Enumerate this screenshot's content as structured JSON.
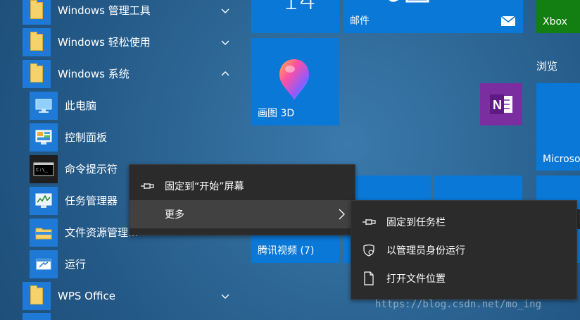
{
  "app_list": {
    "folders": [
      {
        "label": "Windows 管理工具",
        "expanded": false
      },
      {
        "label": "Windows 轻松使用",
        "expanded": false
      },
      {
        "label": "Windows 系统",
        "expanded": true
      }
    ],
    "system_items": [
      {
        "label": "此电脑",
        "icon": "this-pc-icon"
      },
      {
        "label": "控制面板",
        "icon": "control-panel-icon"
      },
      {
        "label": "命令提示符",
        "icon": "command-prompt-icon"
      },
      {
        "label": "任务管理器",
        "icon": "task-manager-icon"
      },
      {
        "label": "文件资源管理...",
        "icon": "file-explorer-icon"
      },
      {
        "label": "运行",
        "icon": "run-icon"
      }
    ],
    "wps_folder": {
      "label": "WPS Office",
      "expanded": false
    }
  },
  "tiles": {
    "calendar_number": "14",
    "mail": "邮件",
    "xbox": "Xbox",
    "paint3d": "画图 3D",
    "browse_group": "浏览",
    "microsoft": "Microso",
    "tencent_video": "腾讯视频 (7)"
  },
  "context_menu": {
    "pin_start": "固定到“开始”屏幕",
    "more": "更多"
  },
  "submenu": {
    "pin_taskbar": "固定到任务栏",
    "run_as_admin": "以管理员身份运行",
    "open_location": "打开文件位置"
  },
  "colors": {
    "tile_blue": "#0a78d7",
    "xbox_green": "#137f12",
    "onenote_purple": "#7b2ea0",
    "menu_bg": "#2b2b2b",
    "menu_highlight": "#414141"
  },
  "watermark": "https://blog.csdn.net/mo_ing"
}
